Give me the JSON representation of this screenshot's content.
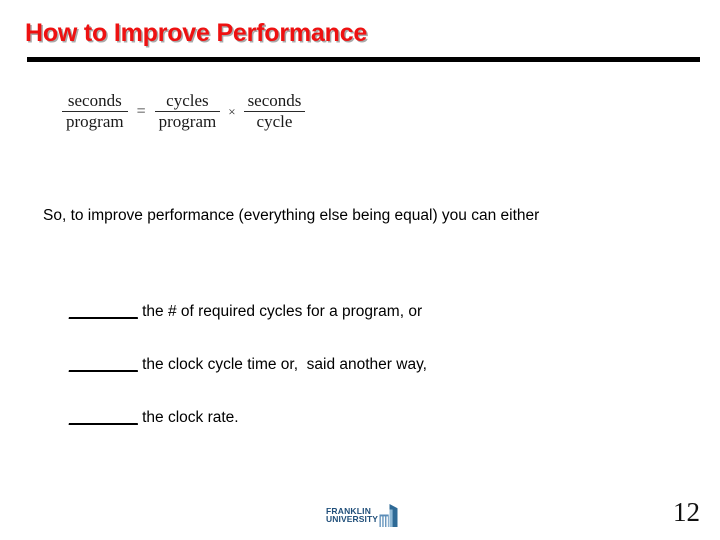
{
  "slide": {
    "title": "How to Improve Performance",
    "page_number": "12",
    "title_color": "#EE1111",
    "rule_color": "#000000"
  },
  "formula": {
    "left": {
      "numerator": "seconds",
      "denominator": "program"
    },
    "equals": "=",
    "middle": {
      "numerator": "cycles",
      "denominator": "program"
    },
    "times": "×",
    "right": {
      "numerator": "seconds",
      "denominator": "cycle"
    }
  },
  "body": {
    "lead": "So, to improve performance (everything else being equal) you can either",
    "bullets": [
      {
        "blank": "________",
        "text": " the # of required cycles for a program, or"
      },
      {
        "blank": "________",
        "text": " the clock cycle time or,  said another way,"
      },
      {
        "blank": "________",
        "text": " the clock rate."
      }
    ]
  },
  "logo": {
    "line1": "FRANKLIN",
    "line2": "UNIVERSITY",
    "color": "#1F4E79",
    "mark_color": "#5B8DB8"
  }
}
